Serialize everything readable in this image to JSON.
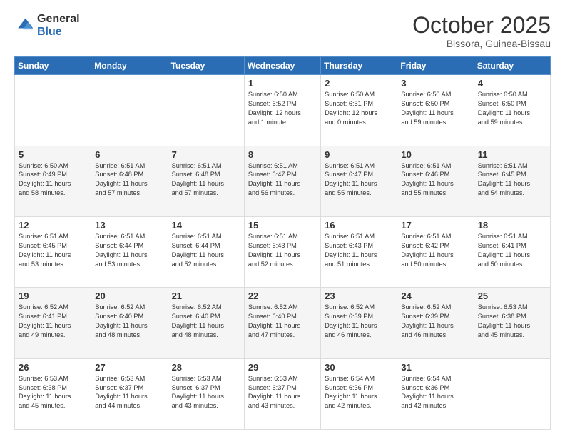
{
  "logo": {
    "general": "General",
    "blue": "Blue"
  },
  "header": {
    "month": "October 2025",
    "location": "Bissora, Guinea-Bissau"
  },
  "days_of_week": [
    "Sunday",
    "Monday",
    "Tuesday",
    "Wednesday",
    "Thursday",
    "Friday",
    "Saturday"
  ],
  "weeks": [
    [
      {
        "day": "",
        "info": ""
      },
      {
        "day": "",
        "info": ""
      },
      {
        "day": "",
        "info": ""
      },
      {
        "day": "1",
        "info": "Sunrise: 6:50 AM\nSunset: 6:52 PM\nDaylight: 12 hours\nand 1 minute."
      },
      {
        "day": "2",
        "info": "Sunrise: 6:50 AM\nSunset: 6:51 PM\nDaylight: 12 hours\nand 0 minutes."
      },
      {
        "day": "3",
        "info": "Sunrise: 6:50 AM\nSunset: 6:50 PM\nDaylight: 11 hours\nand 59 minutes."
      },
      {
        "day": "4",
        "info": "Sunrise: 6:50 AM\nSunset: 6:50 PM\nDaylight: 11 hours\nand 59 minutes."
      }
    ],
    [
      {
        "day": "5",
        "info": "Sunrise: 6:50 AM\nSunset: 6:49 PM\nDaylight: 11 hours\nand 58 minutes."
      },
      {
        "day": "6",
        "info": "Sunrise: 6:51 AM\nSunset: 6:48 PM\nDaylight: 11 hours\nand 57 minutes."
      },
      {
        "day": "7",
        "info": "Sunrise: 6:51 AM\nSunset: 6:48 PM\nDaylight: 11 hours\nand 57 minutes."
      },
      {
        "day": "8",
        "info": "Sunrise: 6:51 AM\nSunset: 6:47 PM\nDaylight: 11 hours\nand 56 minutes."
      },
      {
        "day": "9",
        "info": "Sunrise: 6:51 AM\nSunset: 6:47 PM\nDaylight: 11 hours\nand 55 minutes."
      },
      {
        "day": "10",
        "info": "Sunrise: 6:51 AM\nSunset: 6:46 PM\nDaylight: 11 hours\nand 55 minutes."
      },
      {
        "day": "11",
        "info": "Sunrise: 6:51 AM\nSunset: 6:45 PM\nDaylight: 11 hours\nand 54 minutes."
      }
    ],
    [
      {
        "day": "12",
        "info": "Sunrise: 6:51 AM\nSunset: 6:45 PM\nDaylight: 11 hours\nand 53 minutes."
      },
      {
        "day": "13",
        "info": "Sunrise: 6:51 AM\nSunset: 6:44 PM\nDaylight: 11 hours\nand 53 minutes."
      },
      {
        "day": "14",
        "info": "Sunrise: 6:51 AM\nSunset: 6:44 PM\nDaylight: 11 hours\nand 52 minutes."
      },
      {
        "day": "15",
        "info": "Sunrise: 6:51 AM\nSunset: 6:43 PM\nDaylight: 11 hours\nand 52 minutes."
      },
      {
        "day": "16",
        "info": "Sunrise: 6:51 AM\nSunset: 6:43 PM\nDaylight: 11 hours\nand 51 minutes."
      },
      {
        "day": "17",
        "info": "Sunrise: 6:51 AM\nSunset: 6:42 PM\nDaylight: 11 hours\nand 50 minutes."
      },
      {
        "day": "18",
        "info": "Sunrise: 6:51 AM\nSunset: 6:41 PM\nDaylight: 11 hours\nand 50 minutes."
      }
    ],
    [
      {
        "day": "19",
        "info": "Sunrise: 6:52 AM\nSunset: 6:41 PM\nDaylight: 11 hours\nand 49 minutes."
      },
      {
        "day": "20",
        "info": "Sunrise: 6:52 AM\nSunset: 6:40 PM\nDaylight: 11 hours\nand 48 minutes."
      },
      {
        "day": "21",
        "info": "Sunrise: 6:52 AM\nSunset: 6:40 PM\nDaylight: 11 hours\nand 48 minutes."
      },
      {
        "day": "22",
        "info": "Sunrise: 6:52 AM\nSunset: 6:40 PM\nDaylight: 11 hours\nand 47 minutes."
      },
      {
        "day": "23",
        "info": "Sunrise: 6:52 AM\nSunset: 6:39 PM\nDaylight: 11 hours\nand 46 minutes."
      },
      {
        "day": "24",
        "info": "Sunrise: 6:52 AM\nSunset: 6:39 PM\nDaylight: 11 hours\nand 46 minutes."
      },
      {
        "day": "25",
        "info": "Sunrise: 6:53 AM\nSunset: 6:38 PM\nDaylight: 11 hours\nand 45 minutes."
      }
    ],
    [
      {
        "day": "26",
        "info": "Sunrise: 6:53 AM\nSunset: 6:38 PM\nDaylight: 11 hours\nand 45 minutes."
      },
      {
        "day": "27",
        "info": "Sunrise: 6:53 AM\nSunset: 6:37 PM\nDaylight: 11 hours\nand 44 minutes."
      },
      {
        "day": "28",
        "info": "Sunrise: 6:53 AM\nSunset: 6:37 PM\nDaylight: 11 hours\nand 43 minutes."
      },
      {
        "day": "29",
        "info": "Sunrise: 6:53 AM\nSunset: 6:37 PM\nDaylight: 11 hours\nand 43 minutes."
      },
      {
        "day": "30",
        "info": "Sunrise: 6:54 AM\nSunset: 6:36 PM\nDaylight: 11 hours\nand 42 minutes."
      },
      {
        "day": "31",
        "info": "Sunrise: 6:54 AM\nSunset: 6:36 PM\nDaylight: 11 hours\nand 42 minutes."
      },
      {
        "day": "",
        "info": ""
      }
    ]
  ]
}
